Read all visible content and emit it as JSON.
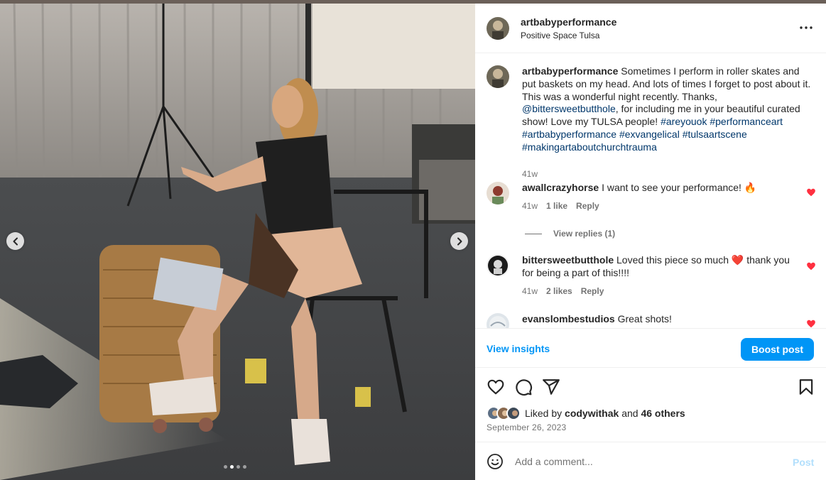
{
  "post": {
    "username": "artbabyperformance",
    "location": "Positive Space Tulsa",
    "more_icon": "more-horizontal-icon"
  },
  "caption": {
    "username": "artbabyperformance",
    "text_1": "Sometimes I perform in roller skates and put baskets on my head. And lots of times I forget to post about it. This was a wonderful night recently. Thanks, ",
    "mention": "@bittersweetbutthole",
    "text_2": ", for including me in your beautiful curated show! Love my TULSA people! ",
    "hashtags": "#areyouok #performanceart #artbabyperformance #exvangelical #tulsaartscene #makingartaboutchurchtrauma",
    "time": "41w"
  },
  "comments": [
    {
      "username": "awallcrazyhorse",
      "text": "I want to see your performance! 🔥",
      "time": "41w",
      "likes": "1 like",
      "reply": "Reply",
      "liked": true
    },
    {
      "username": "bittersweetbutthole",
      "text": "Loved this piece so much ❤️ thank you for being a part of this!!!!",
      "time": "41w",
      "likes": "2 likes",
      "reply": "Reply",
      "liked": true
    },
    {
      "username": "evanslombestudios",
      "text": "Great shots!",
      "liked": true
    }
  ],
  "view_replies": "View replies (1)",
  "insights": {
    "view_label": "View insights",
    "boost_label": "Boost post"
  },
  "likes": {
    "prefix": "Liked by",
    "user": "codywithak",
    "and": "and",
    "others": "46 others"
  },
  "date": "September 26, 2023",
  "add_comment": {
    "placeholder": "Add a comment...",
    "post_label": "Post"
  },
  "carousel": {
    "slide_count": 4,
    "active_slide": 2
  },
  "colors": {
    "accent": "#0095f6",
    "like_red": "#ff3040",
    "link": "#00376b",
    "muted": "#737373"
  }
}
